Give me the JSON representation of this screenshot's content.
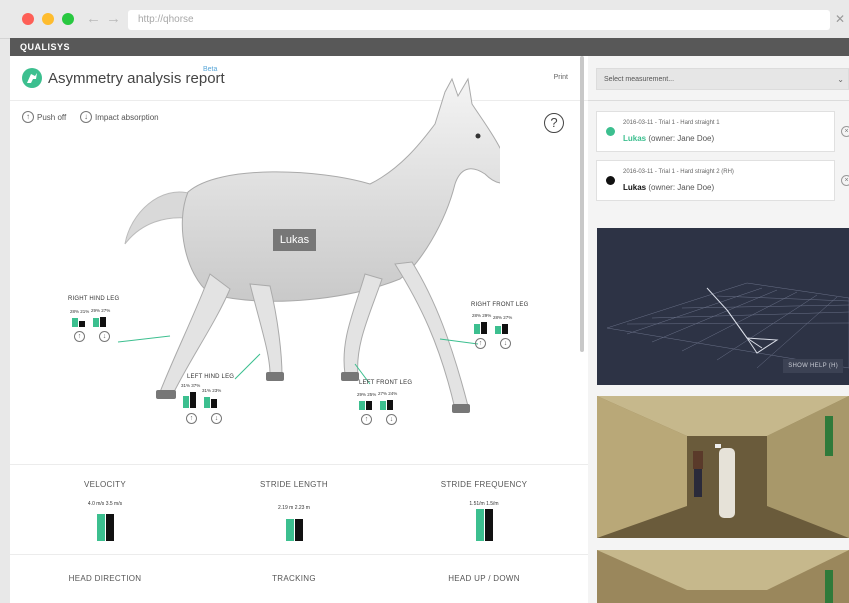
{
  "browser": {
    "url": "http://qhorse",
    "back_icon": "arrow-left-icon",
    "forward_icon": "arrow-right-icon"
  },
  "brand": "QUALISYS",
  "report": {
    "title": "Asymmetry analysis report",
    "beta": "Beta",
    "print": "Print",
    "legend_push_off": "Push off",
    "legend_impact": "Impact absorption",
    "help": "?",
    "horse_name": "Lukas"
  },
  "legs": {
    "right_hind": {
      "label": "RIGHT HIND LEG",
      "left_val": "28% 21%",
      "right_val": "29% 27%",
      "bars": [
        [
          0.55,
          0.35
        ],
        [
          0.55,
          0.6
        ]
      ]
    },
    "left_hind": {
      "label": "LEFT HIND LEG",
      "left_val": "31% 37%",
      "right_val": "31% 23%",
      "bars": [
        [
          0.65,
          0.8
        ],
        [
          0.6,
          0.5
        ]
      ]
    },
    "left_front": {
      "label": "LEFT FRONT LEG",
      "left_val": "29% 25%",
      "right_val": "27% 24%",
      "bars": [
        [
          0.55,
          0.5
        ],
        [
          0.55,
          0.55
        ]
      ]
    },
    "right_front": {
      "label": "RIGHT FRONT LEG",
      "left_val": "28% 29%",
      "right_val": "28% 27%",
      "bars": [
        [
          0.6,
          0.65
        ],
        [
          0.5,
          0.6
        ]
      ]
    }
  },
  "metrics": [
    {
      "title": "VELOCITY",
      "vals": "4.0 m/s 3.5 m/s",
      "bars": [
        0.85,
        0.85
      ]
    },
    {
      "title": "STRIDE LENGTH",
      "vals": "2.19 m 2.23 m",
      "bars": [
        0.65,
        0.65
      ]
    },
    {
      "title": "STRIDE FREQUENCY",
      "vals": "1.51/m 1.5/m",
      "bars": [
        1.0,
        1.0
      ]
    }
  ],
  "metrics_row2": [
    "HEAD DIRECTION",
    "TRACKING",
    "HEAD UP / DOWN"
  ],
  "sidebar": {
    "select_placeholder": "Select measurement...",
    "measurements": [
      {
        "meas": "2016-03-11 - Trial 1 - Hard straight 1",
        "name": "Lukas",
        "owner": "(owner: Jane Doe)",
        "color": "#3cbf8f"
      },
      {
        "meas": "2016-03-11 - Trial 1 - Hard straight 2 (RH)",
        "name": "Lukas",
        "owner": "(owner: Jane Doe)",
        "color": "#111111"
      }
    ],
    "show_help": "SHOW HELP (H)"
  },
  "colors": {
    "accent": "#3cbf8f",
    "dark": "#111111",
    "brandbar": "#585858"
  }
}
